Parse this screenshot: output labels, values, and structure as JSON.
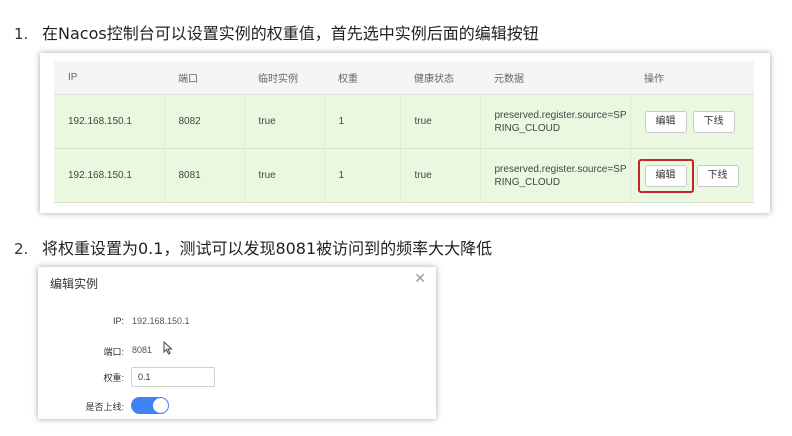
{
  "step1": {
    "number": "1.",
    "text": "在Nacos控制台可以设置实例的权重值，首先选中实例后面的编辑按钮"
  },
  "step2": {
    "number": "2.",
    "text": "将权重设置为0.1，测试可以发现8081被访问到的频率大大降低"
  },
  "table": {
    "headers": [
      "IP",
      "端口",
      "临时实例",
      "权重",
      "健康状态",
      "元数据",
      "操作"
    ],
    "rows": [
      {
        "ip": "192.168.150.1",
        "port": "8082",
        "ephemeral": "true",
        "weight": "1",
        "healthy": "true",
        "metadata": "preserved.register.source=SPRING_CLOUD",
        "edit": "编辑",
        "offline": "下线"
      },
      {
        "ip": "192.168.150.1",
        "port": "8081",
        "ephemeral": "true",
        "weight": "1",
        "healthy": "true",
        "metadata": "preserved.register.source=SPRING_CLOUD",
        "edit": "编辑",
        "offline": "下线"
      }
    ],
    "highlight_color": "#c0262b",
    "row_bg": "#eaf8e0"
  },
  "dialog": {
    "title": "编辑实例",
    "close_icon": "close-icon",
    "ip_label": "IP:",
    "ip_value": "192.168.150.1",
    "port_label": "端口:",
    "port_value": "8081",
    "weight_label": "权重:",
    "weight_value": "0.1",
    "online_label": "是否上线:",
    "online": true,
    "toggle_color": "#3f84f2"
  }
}
